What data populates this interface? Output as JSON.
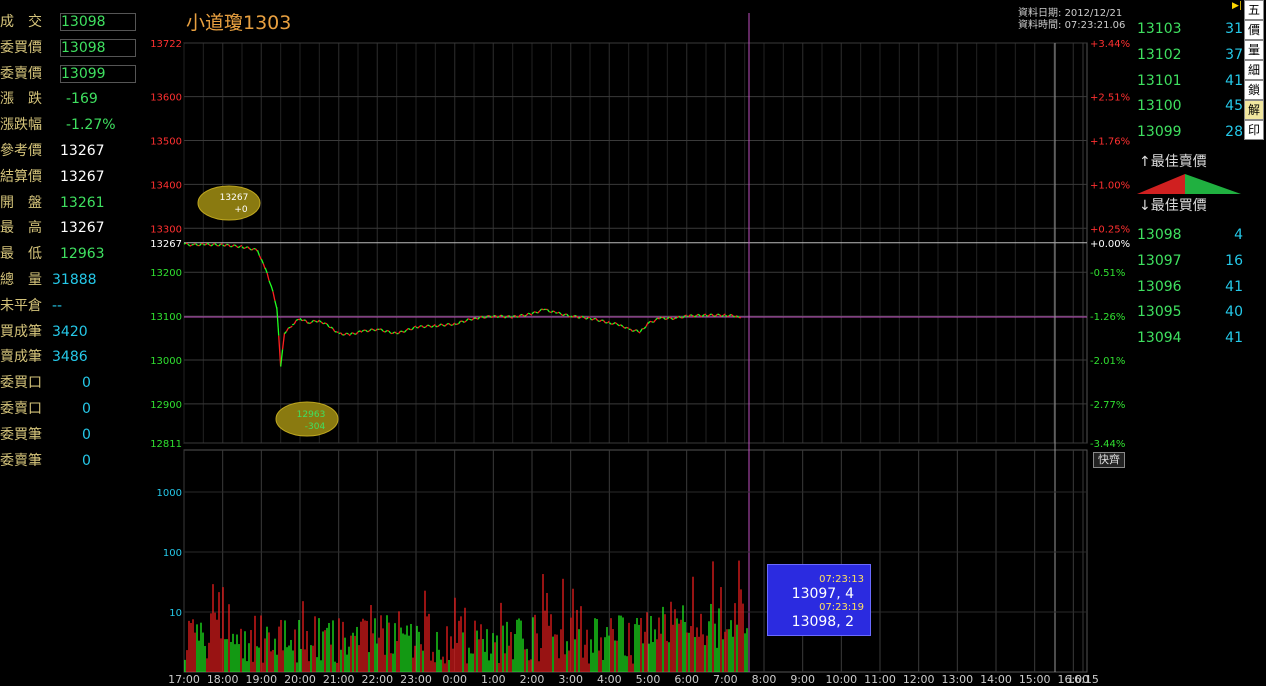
{
  "title": "小道瓊1303",
  "info": {
    "date_label": "資料日期:",
    "date": "2012/12/21",
    "time_label": "資料時間:",
    "time": "07:23:21.06"
  },
  "left_panel": [
    {
      "label": "成　交",
      "value": "13098",
      "color": "#3fe060",
      "boxed": true
    },
    {
      "label": "委買價",
      "value": "13098",
      "color": "#3fe060",
      "boxed": true
    },
    {
      "label": "委賣價",
      "value": "13099",
      "color": "#3fe060",
      "boxed": true
    },
    {
      "label": "漲　跌",
      "value": "-169",
      "color": "#3fe060"
    },
    {
      "label": "漲跌幅",
      "value": "-1.27%",
      "color": "#3fe060"
    },
    {
      "label": "參考價",
      "value": "13267",
      "color": "#ffffff"
    },
    {
      "label": "結算價",
      "value": "13267",
      "color": "#ffffff"
    },
    {
      "label": "開　盤",
      "value": "13261",
      "color": "#3fe060"
    },
    {
      "label": "最　高",
      "value": "13267",
      "color": "#ffffff"
    },
    {
      "label": "最　低",
      "value": "12963",
      "color": "#3fe060"
    },
    {
      "label": "總　量",
      "value": "31888",
      "color": "#25c8e8"
    },
    {
      "label": "未平倉",
      "value": "--",
      "color": "#25c8e8"
    },
    {
      "label": "買成筆",
      "value": "3420",
      "color": "#25c8e8"
    },
    {
      "label": "賣成筆",
      "value": "3486",
      "color": "#25c8e8"
    },
    {
      "label": "委買口",
      "value": "0",
      "color": "#25c8e8"
    },
    {
      "label": "委賣口",
      "value": "0",
      "color": "#25c8e8"
    },
    {
      "label": "委買筆",
      "value": "0",
      "color": "#25c8e8"
    },
    {
      "label": "委賣筆",
      "value": "0",
      "color": "#25c8e8"
    }
  ],
  "asks": [
    {
      "price": "13103",
      "volume": "31"
    },
    {
      "price": "13102",
      "volume": "37"
    },
    {
      "price": "13101",
      "volume": "41"
    },
    {
      "price": "13100",
      "volume": "45"
    },
    {
      "price": "13099",
      "volume": "28"
    }
  ],
  "best_ask_label": "最佳賣價",
  "best_bid_label": "最佳買價",
  "bids": [
    {
      "price": "13098",
      "volume": "4"
    },
    {
      "price": "13097",
      "volume": "16"
    },
    {
      "price": "13096",
      "volume": "41"
    },
    {
      "price": "13095",
      "volume": "40"
    },
    {
      "price": "13094",
      "volume": "41"
    }
  ],
  "side_buttons": [
    "五",
    "價",
    "量",
    "細",
    "鎖",
    "解",
    "印"
  ],
  "kuai_label": "快齊",
  "tick_box": {
    "time1": "07:23:13",
    "val1": "13097, 4",
    "time2": "07:23:19",
    "val2": "13098, 2"
  },
  "callouts": {
    "high": {
      "price": "13267",
      "change": "+0"
    },
    "low": {
      "price": "12963",
      "change": "-304"
    }
  },
  "colors": {
    "up": "#ff2020",
    "down": "#20ff20",
    "grid": "#3a3a3a",
    "accent": "#e8a040",
    "cursor": "#c050c0"
  },
  "chart_data": {
    "type": "line",
    "price_ticks": [
      "13722",
      "13600",
      "13500",
      "13400",
      "13300",
      "13267",
      "13200",
      "13100",
      "13000",
      "12900",
      "12811"
    ],
    "pct_ticks": [
      "+3.44%",
      "+2.51%",
      "+1.76%",
      "+1.00%",
      "+0.25%",
      "+0.00%",
      "-0.51%",
      "-1.26%",
      "-2.01%",
      "-2.77%",
      "-3.44%"
    ],
    "reference": 13267,
    "current": 13098,
    "ylim": [
      12811,
      13722
    ],
    "x_ticks": [
      "17:00",
      "18:00",
      "19:00",
      "20:00",
      "21:00",
      "22:00",
      "23:00",
      "0:00",
      "1:00",
      "2:00",
      "3:00",
      "4:00",
      "5:00",
      "6:00",
      "7:00",
      "8:00",
      "9:00",
      "10:00",
      "11:00",
      "12:00",
      "13:00",
      "14:00",
      "15:00",
      "16:00",
      "16:15"
    ],
    "price_series_x": [
      0,
      0.2,
      0.5,
      1.0,
      1.5,
      1.9,
      2.0,
      2.1,
      2.25,
      2.4,
      2.5,
      2.6,
      2.8,
      3.0,
      3.2,
      3.5,
      3.8,
      4.0,
      4.3,
      4.6,
      5.0,
      5.5,
      6.0,
      6.5,
      7.0,
      7.5,
      8.0,
      8.5,
      9.0,
      9.3,
      9.6,
      10.0,
      10.5,
      11.0,
      11.3,
      11.5,
      11.8,
      12.0,
      12.3,
      12.7,
      13.0,
      13.5,
      14.0,
      14.3,
      14.4
    ],
    "price_series_y": [
      13264,
      13262,
      13263,
      13262,
      13258,
      13250,
      13230,
      13210,
      13170,
      13120,
      12985,
      13060,
      13080,
      13095,
      13085,
      13090,
      13075,
      13060,
      13058,
      13065,
      13070,
      13060,
      13075,
      13078,
      13082,
      13095,
      13100,
      13098,
      13105,
      13115,
      13108,
      13100,
      13095,
      13085,
      13080,
      13070,
      13064,
      13083,
      13095,
      13095,
      13100,
      13102,
      13102,
      13100,
      13098
    ],
    "volume_ticks": [
      "1000",
      "100",
      "10"
    ]
  }
}
